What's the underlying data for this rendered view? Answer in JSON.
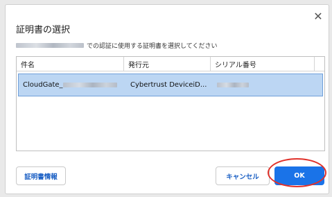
{
  "dialog": {
    "title": "証明書の選択",
    "description_suffix": "での認証に使用する証明書を選択してください",
    "close_icon": "close-icon"
  },
  "table": {
    "columns": [
      "件名",
      "発行元",
      "シリアル番号"
    ],
    "rows": [
      {
        "subject": "CloudGate_",
        "issuer": "Cybertrust DeviceiD...",
        "serial": ""
      }
    ]
  },
  "buttons": {
    "info": "証明書情報",
    "cancel": "キャンセル",
    "ok": "OK"
  },
  "colors": {
    "accent": "#1a73e8",
    "selection": "#bcd6f3",
    "annotation": "#e0322b"
  }
}
